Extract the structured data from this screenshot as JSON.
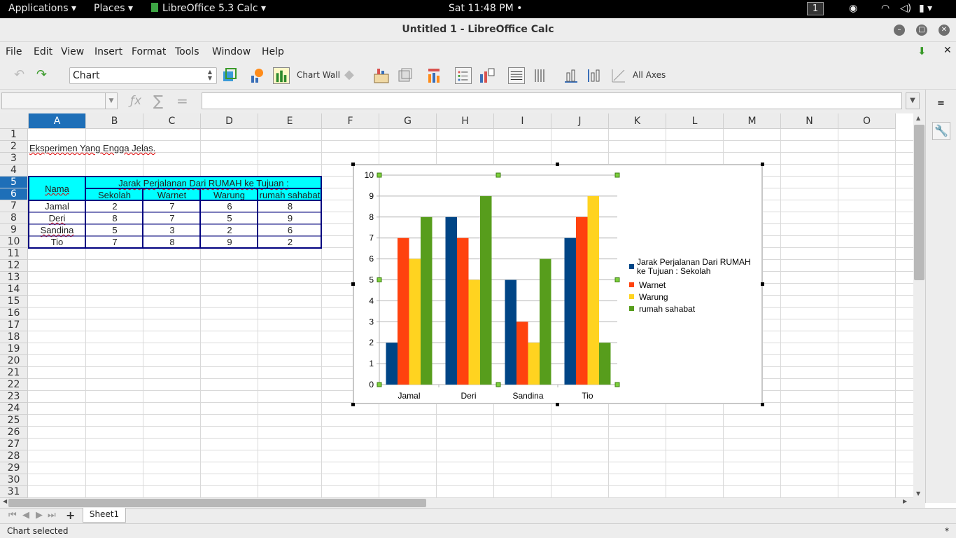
{
  "topbar": {
    "applications": "Applications",
    "places": "Places",
    "app_menu": "LibreOffice 5.3 Calc",
    "clock": "Sat 11:48 PM",
    "workspace": "1"
  },
  "window": {
    "title": "Untitled 1 - LibreOffice Calc"
  },
  "menu": [
    "File",
    "Edit",
    "View",
    "Insert",
    "Format",
    "Tools",
    "Window",
    "Help"
  ],
  "toolbar": {
    "element_select": "Chart",
    "format_selection_label": "Chart Wall",
    "axes_label": "All Axes"
  },
  "formula": {
    "name_box": "",
    "input": ""
  },
  "columns": [
    "A",
    "B",
    "C",
    "D",
    "E",
    "F",
    "G",
    "H",
    "I",
    "J",
    "K",
    "L",
    "M",
    "N",
    "O"
  ],
  "rows": [
    "1",
    "2",
    "3",
    "4",
    "5",
    "6",
    "7",
    "8",
    "9",
    "10",
    "11",
    "12",
    "13",
    "14",
    "15",
    "16",
    "17",
    "18",
    "19",
    "20",
    "21",
    "22",
    "23",
    "24",
    "25",
    "26",
    "27",
    "28",
    "29",
    "30",
    "31"
  ],
  "sheet": {
    "a2": "Eksperimen Yang Engga Jelas.",
    "header_nama": "Nama",
    "header_group": "Jarak Perjalanan Dari RUMAH ke Tujuan :",
    "subheaders": [
      "Sekolah",
      "Warnet",
      "Warung",
      "rumah sahabat"
    ],
    "data_rows": [
      {
        "name": "Jamal",
        "values": [
          "2",
          "7",
          "6",
          "8"
        ]
      },
      {
        "name": "Deri",
        "values": [
          "8",
          "7",
          "5",
          "9"
        ]
      },
      {
        "name": "Sandina",
        "values": [
          "5",
          "3",
          "2",
          "6"
        ]
      },
      {
        "name": "Tio",
        "values": [
          "7",
          "8",
          "9",
          "2"
        ]
      }
    ]
  },
  "chart_data": {
    "type": "bar",
    "categories": [
      "Jamal",
      "Deri",
      "Sandina",
      "Tio"
    ],
    "series": [
      {
        "name": "Jarak Perjalanan Dari RUMAH ke Tujuan : Sekolah",
        "values": [
          2,
          8,
          5,
          7
        ],
        "color": "#004586"
      },
      {
        "name": "Warnet",
        "values": [
          7,
          7,
          3,
          8
        ],
        "color": "#ff420e"
      },
      {
        "name": "Warung",
        "values": [
          6,
          5,
          2,
          9
        ],
        "color": "#ffd320"
      },
      {
        "name": "rumah sahabat",
        "values": [
          8,
          9,
          6,
          2
        ],
        "color": "#579d1c"
      }
    ],
    "legend_lines": [
      "Jarak Perjalanan Dari RUMAH",
      "ke Tujuan : Sekolah"
    ],
    "ylim": [
      0,
      10
    ],
    "yticks": [
      "0",
      "1",
      "2",
      "3",
      "4",
      "5",
      "6",
      "7",
      "8",
      "9",
      "10"
    ],
    "grid": true,
    "legend_position": "right"
  },
  "tabs": {
    "sheet1": "Sheet1"
  },
  "status": {
    "text": "Chart selected",
    "modified": "*"
  },
  "colors": {
    "header_fill": "#00ffff",
    "selection_blue": "#1e6fb8",
    "table_border": "#000080"
  }
}
